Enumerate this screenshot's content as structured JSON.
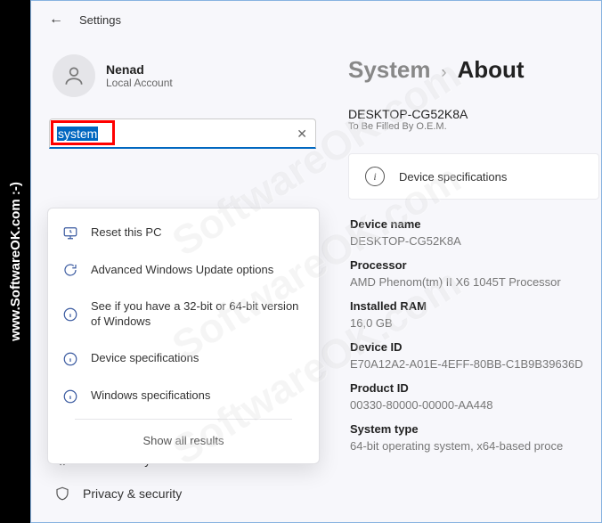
{
  "leftbar": "www.SoftwareOK.com :-)",
  "watermark": "SoftwareOK.com",
  "header": {
    "title": "Settings"
  },
  "profile": {
    "name": "Nenad",
    "sub": "Local Account"
  },
  "search": {
    "value": "system"
  },
  "dropdown": {
    "items": [
      {
        "label": "Reset this PC"
      },
      {
        "label": "Advanced Windows Update options"
      },
      {
        "label": "See if you have a 32-bit or 64-bit version of Windows"
      },
      {
        "label": "Device specifications"
      },
      {
        "label": "Windows specifications"
      }
    ],
    "showall": "Show all results"
  },
  "nav": {
    "items": [
      {
        "label": "Accessibility"
      },
      {
        "label": "Privacy & security"
      }
    ]
  },
  "breadcrumb": {
    "root": "System",
    "page": "About"
  },
  "device": {
    "name": "DESKTOP-CG52K8A",
    "sub": "To Be Filled By O.E.M."
  },
  "spec_card": {
    "title": "Device specifications"
  },
  "specs": [
    {
      "label": "Device name",
      "value": "DESKTOP-CG52K8A"
    },
    {
      "label": "Processor",
      "value": "AMD Phenom(tm) II X6 1045T Processor"
    },
    {
      "label": "Installed RAM",
      "value": "16,0 GB"
    },
    {
      "label": "Device ID",
      "value": "E70A12A2-A01E-4EFF-80BB-C1B9B39636D"
    },
    {
      "label": "Product ID",
      "value": "00330-80000-00000-AA448"
    },
    {
      "label": "System type",
      "value": "64-bit operating system, x64-based proce"
    }
  ]
}
